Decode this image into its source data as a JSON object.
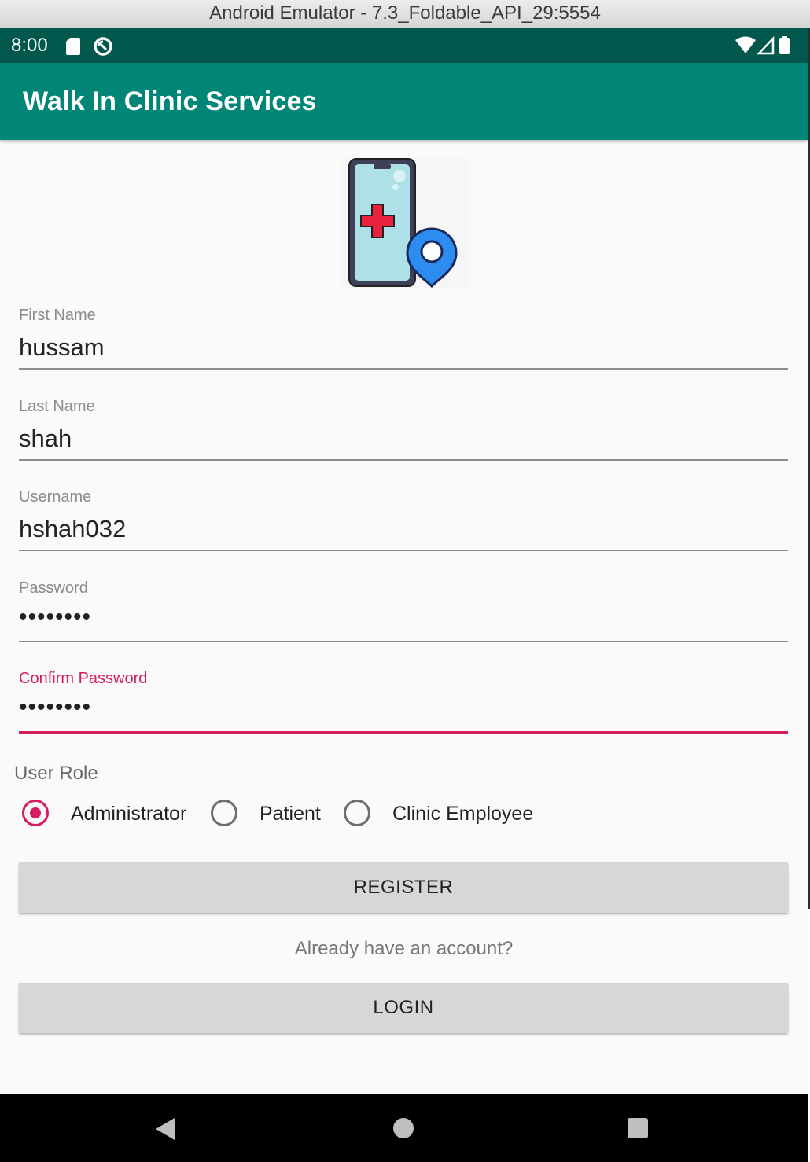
{
  "window": {
    "title": "Android Emulator - 7.3_Foldable_API_29:5554"
  },
  "statusbar": {
    "time": "8:00",
    "icons": [
      "sd-card-icon",
      "sync-icon",
      "wifi-icon",
      "cellular-signal-icon",
      "battery-icon"
    ]
  },
  "appbar": {
    "title": "Walk In Clinic Services",
    "color": "#008577"
  },
  "form": {
    "first_name": {
      "label": "First Name",
      "value": "hussam"
    },
    "last_name": {
      "label": "Last Name",
      "value": "shah"
    },
    "username": {
      "label": "Username",
      "value": "hshah032"
    },
    "password": {
      "label": "Password",
      "value": "••••••••"
    },
    "confirm_password": {
      "label": "Confirm Password",
      "value": "••••••••"
    }
  },
  "user_role": {
    "label": "User Role",
    "options": [
      "Administrator",
      "Patient",
      "Clinic Employee"
    ],
    "selected": "Administrator"
  },
  "register_button": "REGISTER",
  "already_text": "Already have an account?",
  "login_button": "LOGIN",
  "accent_color": "#d81b60",
  "navbar": {
    "icons": [
      "back-icon",
      "home-icon",
      "recents-icon"
    ]
  }
}
